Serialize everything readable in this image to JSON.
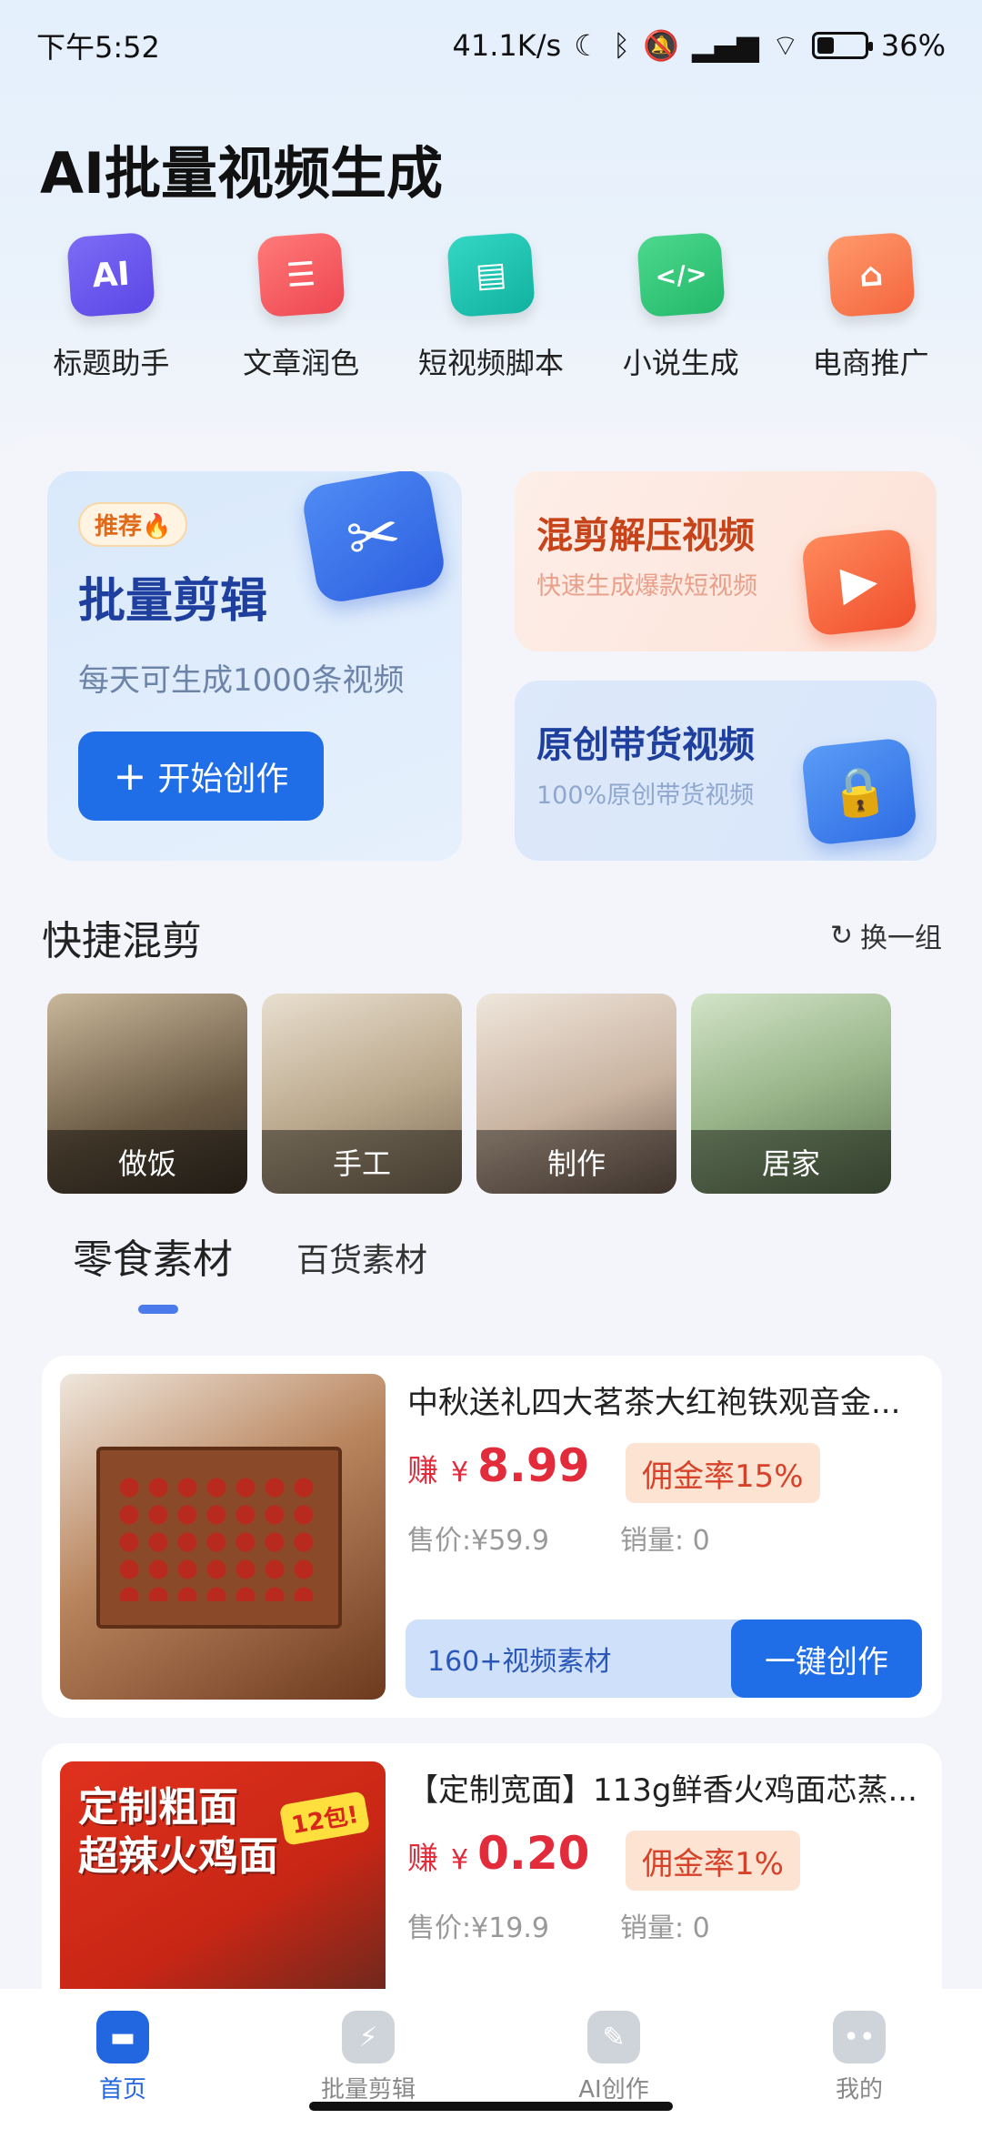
{
  "status_bar": {
    "time": "下午5:52",
    "network_speed": "41.1K/s",
    "battery_percent": "36%",
    "battery_level": 0.36
  },
  "page": {
    "title": "AI批量视频生成"
  },
  "tools": [
    {
      "label": "标题助手",
      "icon": "ai-icon",
      "glyph": "AI",
      "color": "#6b5cf0"
    },
    {
      "label": "文章润色",
      "icon": "document-icon",
      "glyph": "☰",
      "color": "#f2565c"
    },
    {
      "label": "短视频脚本",
      "icon": "clapper-icon",
      "glyph": "▤",
      "color": "#16c0b0"
    },
    {
      "label": "小说生成",
      "icon": "code-icon",
      "glyph": "</>",
      "color": "#2fc57a"
    },
    {
      "label": "电商推广",
      "icon": "shopping-bag-icon",
      "glyph": "⌂",
      "color": "#fb7a52"
    }
  ],
  "feature_main": {
    "badge": "推荐🔥",
    "title": "批量剪辑",
    "subtitle": "每天可生成1000条视频",
    "button_label": "开始创作",
    "button_icon": "+"
  },
  "feature_cards": [
    {
      "title": "混剪解压视频",
      "subtitle": "快速生成爆款短视频",
      "icon": "video-play-icon"
    },
    {
      "title": "原创带货视频",
      "subtitle": "100%原创带货视频",
      "icon": "lock-bag-icon"
    }
  ],
  "quick_mix": {
    "title": "快捷混剪",
    "refresh_label": "换一组",
    "items": [
      "做饭",
      "手工",
      "制作",
      "居家"
    ]
  },
  "tabs": [
    {
      "label": "零食素材",
      "active": true
    },
    {
      "label": "百货素材",
      "active": false
    }
  ],
  "products": [
    {
      "name": "中秋送礼四大茗茶大红袍铁观音金...",
      "earn_label": "赚",
      "currency": "¥",
      "earn_amount": "8.99",
      "commission": "佣金率15%",
      "price": "售价:¥59.9",
      "sales": "销量: 0",
      "material_count": "160+视频素材",
      "create_label": "一键创作"
    },
    {
      "name": "【定制宽面】113g鲜香火鸡面芯蒸...",
      "earn_label": "赚",
      "currency": "¥",
      "earn_amount": "0.20",
      "commission": "佣金率1%",
      "price": "售价:¥19.9",
      "sales": "销量: 0",
      "image_text": "定制粗面\n超辣火鸡面",
      "image_badge": "12包!"
    }
  ],
  "bottom_nav": [
    {
      "label": "首页",
      "active": true,
      "icon": "home-icon"
    },
    {
      "label": "批量剪辑",
      "active": false,
      "icon": "batch-edit-icon"
    },
    {
      "label": "AI创作",
      "active": false,
      "icon": "ai-create-icon"
    },
    {
      "label": "我的",
      "active": false,
      "icon": "profile-icon"
    }
  ]
}
